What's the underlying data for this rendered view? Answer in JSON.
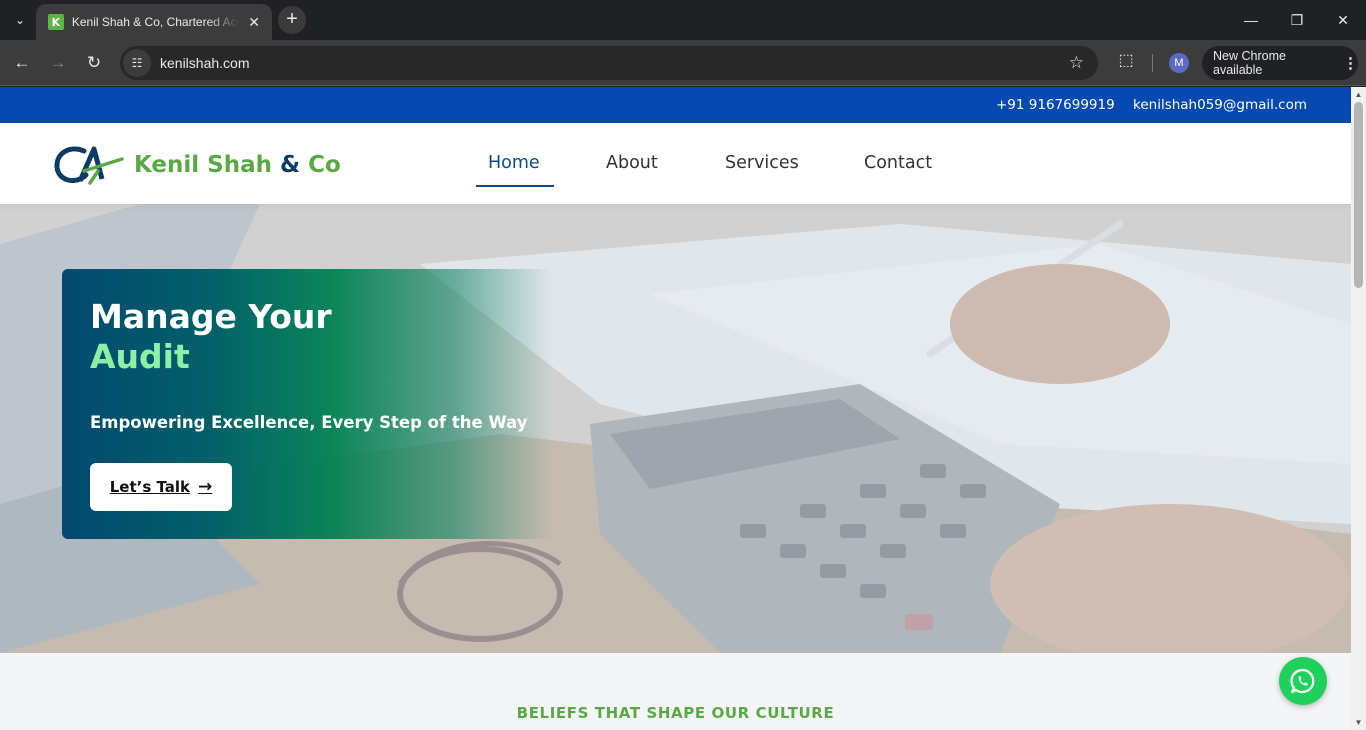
{
  "browser": {
    "tab": {
      "favicon_letter": "K",
      "title": "Kenil Shah & Co, Chartered Accountants"
    },
    "url": "kenilshah.com",
    "profile_initial": "M",
    "update_label": "New Chrome available"
  },
  "site": {
    "topbar": {
      "phone": "+91 9167699919",
      "email": "kenilshah059@gmail.com"
    },
    "logo": {
      "name": "Kenil Shah",
      "amp": "&",
      "suffix": "Co"
    },
    "nav": [
      {
        "label": "Home",
        "active": true
      },
      {
        "label": "About",
        "active": false
      },
      {
        "label": "Services",
        "active": false
      },
      {
        "label": "Contact",
        "active": false
      }
    ],
    "hero": {
      "title_line1": "Manage Your",
      "title_line2": "Audit",
      "subtitle": "Empowering Excellence, Every Step of the Way",
      "cta_label": "Let’s Talk"
    },
    "section_title": "BELIEFS THAT SHAPE OUR CULTURE"
  },
  "colors": {
    "brand_green": "#5aa846",
    "brand_navy": "#0c3b63",
    "topbar_blue": "#0649b0",
    "whatsapp_green": "#1fd05c"
  }
}
